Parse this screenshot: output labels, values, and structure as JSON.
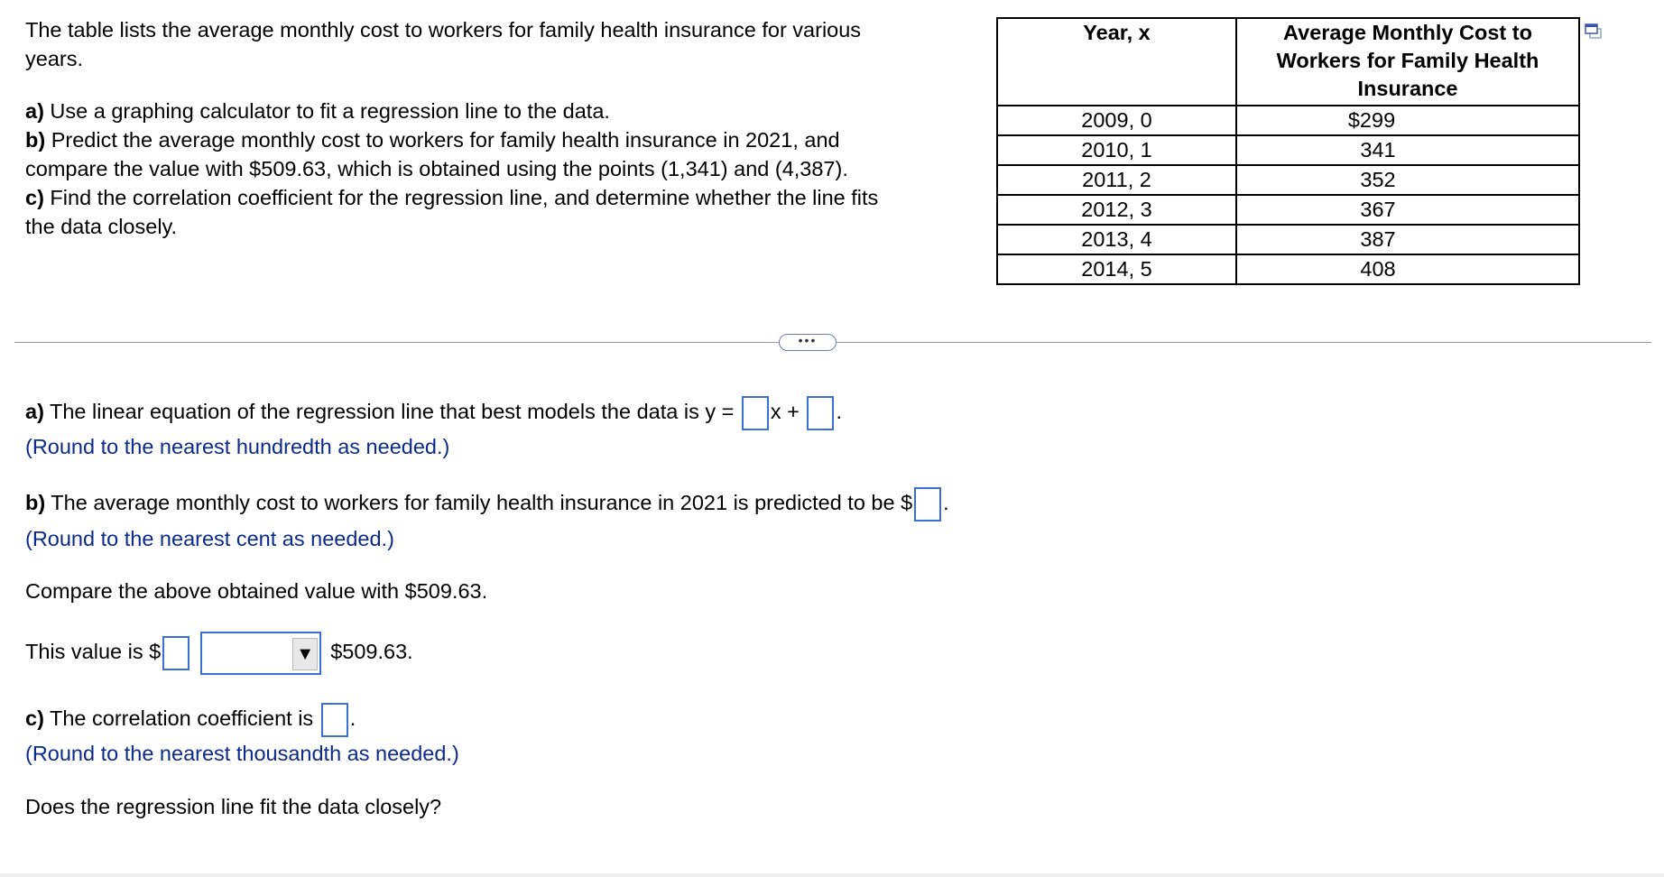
{
  "question": {
    "intro_line1": "The table lists the average monthly cost to workers for family health insurance for various",
    "intro_line2": "years.",
    "parts": [
      {
        "label": "a)",
        "text": " Use a graphing calculator to fit a regression line to the data."
      },
      {
        "label": "b)",
        "text": " Predict the average monthly cost to workers for family health insurance in 2021, and"
      },
      {
        "label": "",
        "text": "compare the value with $509.63, which is obtained using the points (1,341) and (4,387)."
      },
      {
        "label": "c)",
        "text": " Find the correlation coefficient for the regression line, and determine whether the line fits"
      },
      {
        "label": "",
        "text": "the data closely."
      }
    ]
  },
  "table": {
    "headers": [
      "Year, x",
      "Average Monthly Cost to Workers for Family Health Insurance"
    ],
    "rows": [
      [
        "2009, 0",
        "$299"
      ],
      [
        "2010, 1",
        "341"
      ],
      [
        "2011, 2",
        "352"
      ],
      [
        "2012, 3",
        "367"
      ],
      [
        "2013, 4",
        "387"
      ],
      [
        "2014, 5",
        "408"
      ]
    ]
  },
  "divider": {
    "pill": "•••"
  },
  "answers": {
    "a": {
      "label": "a)",
      "text": " The linear equation of the regression line that best models the data is y =",
      "mid": "x +",
      "end": ".",
      "hint": "(Round to the nearest hundredth as needed.)"
    },
    "b": {
      "label": "b)",
      "text": " The average monthly cost to workers for family health insurance in 2021 is predicted to be $",
      "end": ".",
      "hint": "(Round to the nearest cent as needed.)"
    },
    "compare": "Compare the above obtained value with $509.63.",
    "value_is": {
      "prefix": "This value is $",
      "select_value": "",
      "suffix": "$509.63."
    },
    "c": {
      "label": "c)",
      "text": " The correlation coefficient is",
      "end": ".",
      "hint": "(Round to the nearest thousandth as needed.)"
    },
    "fit_question": "Does the regression line fit the data closely?"
  },
  "colors": {
    "hint": "#0b2a8a",
    "input_border": "#3a6fd8"
  }
}
